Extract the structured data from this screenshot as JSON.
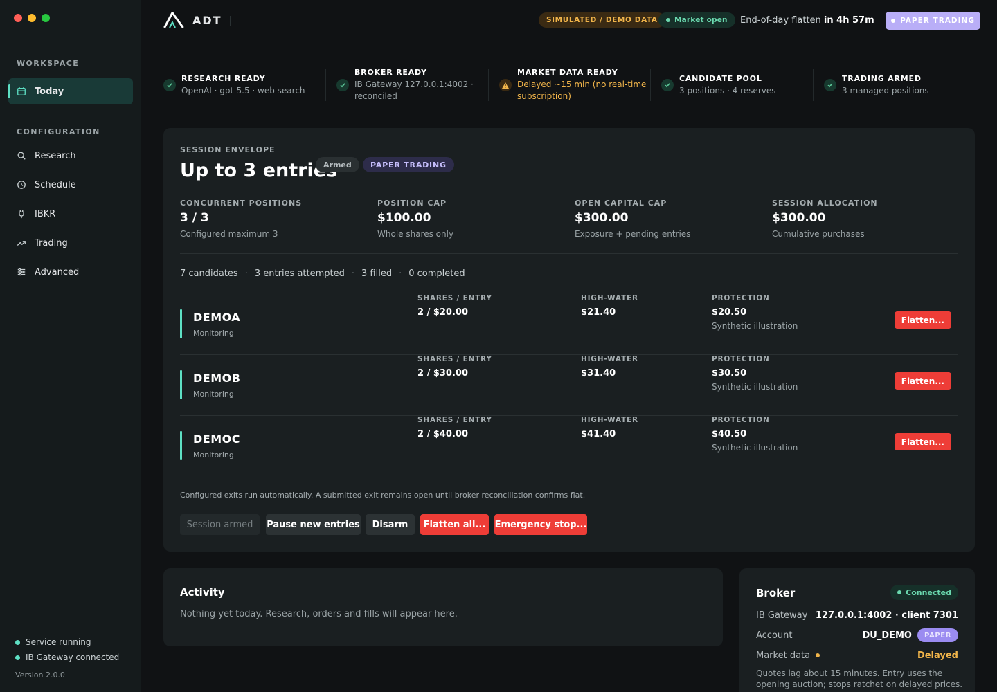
{
  "sidebar": {
    "sections": [
      "WORKSPACE",
      "CONFIGURATION"
    ],
    "items": [
      {
        "label": "Today",
        "icon": "calendar-icon"
      },
      {
        "label": "Research",
        "icon": "search-icon"
      },
      {
        "label": "Schedule",
        "icon": "clock-icon"
      },
      {
        "label": "IBKR",
        "icon": "plug-icon"
      },
      {
        "label": "Trading",
        "icon": "trend-icon"
      },
      {
        "label": "Advanced",
        "icon": "sliders-icon"
      }
    ],
    "status": [
      "Service running",
      "IB Gateway connected"
    ],
    "version": "Version 2.0.0"
  },
  "topbar": {
    "brand": "ADT",
    "simulated": "SIMULATED / DEMO DATA",
    "market": "Market open",
    "flatten_label": "End-of-day flatten",
    "flatten_time": "in 4h 57m",
    "paper_button": "PAPER TRADING"
  },
  "readiness": [
    {
      "title": "RESEARCH READY",
      "detail": "OpenAI · gpt-5.5 · web search",
      "state": "ok"
    },
    {
      "title": "BROKER READY",
      "detail": "IB Gateway 127.0.0.1:4002 ·",
      "detail2": "reconciled",
      "state": "ok"
    },
    {
      "title": "MARKET DATA READY",
      "detail": "Delayed ~15 min (no real-time",
      "detail2": "subscription)",
      "state": "warn"
    },
    {
      "title": "CANDIDATE POOL",
      "detail": "3 positions · 4 reserves",
      "state": "ok"
    },
    {
      "title": "TRADING ARMED",
      "detail": "3 managed positions",
      "state": "ok"
    }
  ],
  "envelope": {
    "label": "SESSION ENVELOPE",
    "title": "Up to 3 entries",
    "tag_armed": "Armed",
    "tag_paper": "PAPER TRADING",
    "metrics": [
      {
        "label": "CONCURRENT POSITIONS",
        "value": "3 / 3",
        "sub": "Configured maximum 3"
      },
      {
        "label": "POSITION CAP",
        "value": "$100.00",
        "sub": "Whole shares only"
      },
      {
        "label": "OPEN CAPITAL CAP",
        "value": "$300.00",
        "sub": "Exposure + pending entries"
      },
      {
        "label": "SESSION ALLOCATION",
        "value": "$300.00",
        "sub": "Cumulative purchases"
      }
    ],
    "summary": [
      "7 candidates",
      "3 entries attempted",
      "3 filled",
      "0 completed"
    ],
    "col_headers": {
      "shares": "SHARES / ENTRY",
      "high": "HIGH-WATER",
      "protection": "PROTECTION"
    },
    "positions": [
      {
        "symbol": "DEMOA",
        "state": "Monitoring",
        "shares": "2 / $20.00",
        "high": "$21.40",
        "protection": "$20.50",
        "note": "Synthetic illustration",
        "action": "Flatten..."
      },
      {
        "symbol": "DEMOB",
        "state": "Monitoring",
        "shares": "2 / $30.00",
        "high": "$31.40",
        "protection": "$30.50",
        "note": "Synthetic illustration",
        "action": "Flatten..."
      },
      {
        "symbol": "DEMOC",
        "state": "Monitoring",
        "shares": "2 / $40.00",
        "high": "$41.40",
        "protection": "$40.50",
        "note": "Synthetic illustration",
        "action": "Flatten..."
      }
    ],
    "note": "Configured exits run automatically. A submitted exit remains open until broker reconciliation confirms flat.",
    "buttons": {
      "armed": "Session armed",
      "pause": "Pause new entries",
      "disarm": "Disarm",
      "flatten_all": "Flatten all...",
      "emergency": "Emergency stop..."
    }
  },
  "activity": {
    "title": "Activity",
    "empty": "Nothing yet today. Research, orders and fills will appear here."
  },
  "broker": {
    "title": "Broker",
    "status": "Connected",
    "rows": [
      {
        "key": "IB Gateway",
        "value": "127.0.0.1:4002 · client 7301"
      },
      {
        "key": "Account",
        "value": "DU_DEMO",
        "chip": "PAPER"
      },
      {
        "key": "Market data",
        "value": "Delayed"
      }
    ],
    "note": "Quotes lag about 15 minutes. Entry uses the opening auction; stops ratchet on delayed prices."
  },
  "colors": {
    "accent": "#5ee0c4",
    "success": "#3fb97f",
    "warning": "#f0b44a",
    "danger": "#ee3d37",
    "paper": "#b9aef7"
  }
}
